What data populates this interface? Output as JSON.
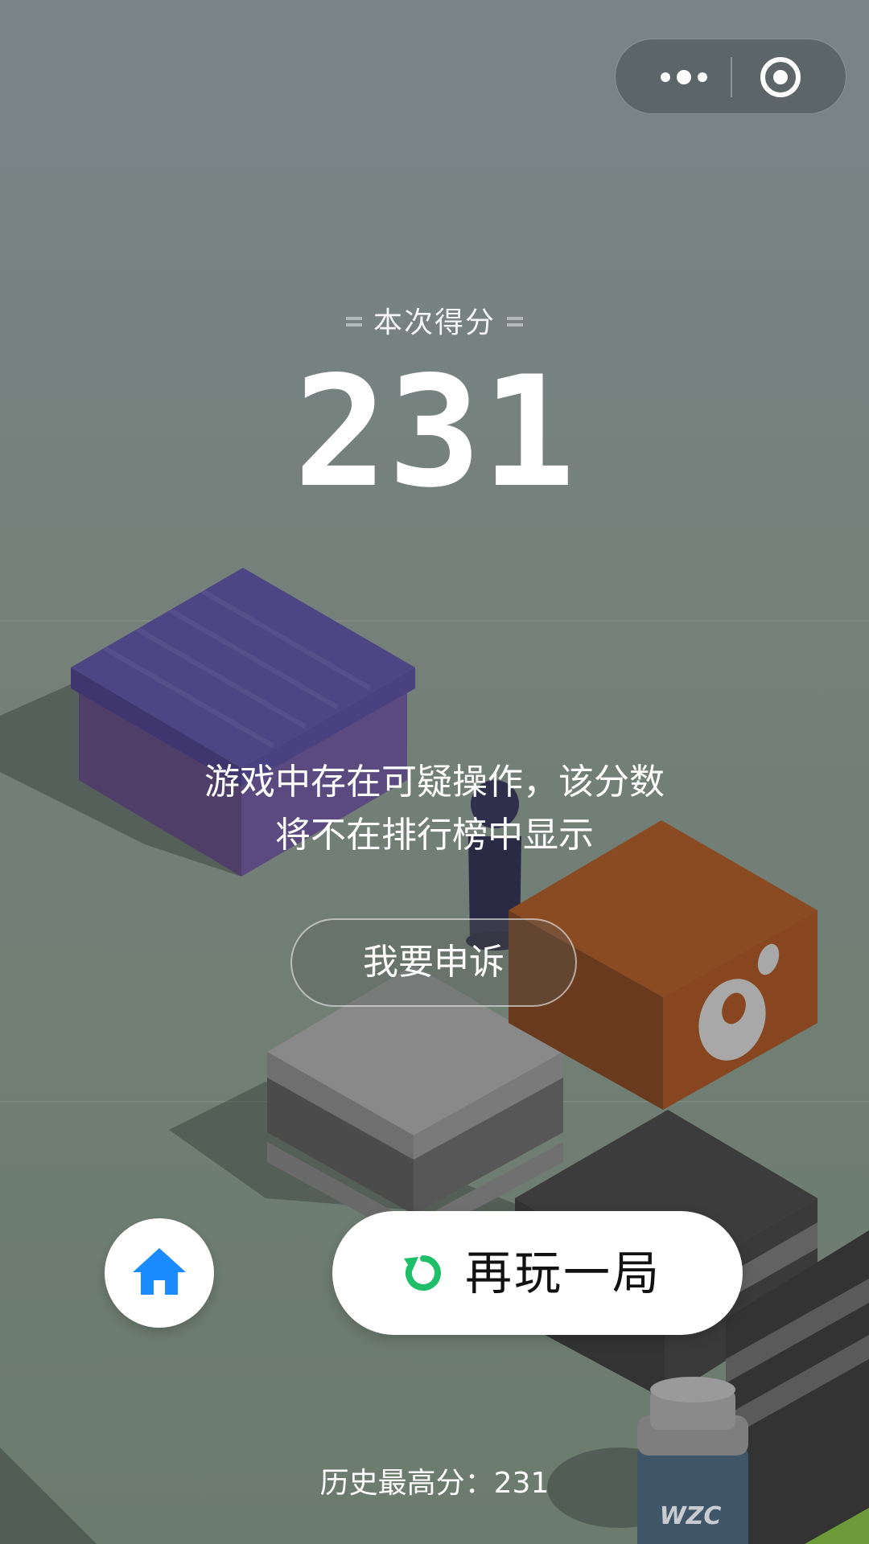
{
  "colors": {
    "accent_green": "#1fbf6a",
    "home_blue": "#1a8cff",
    "purple_box": "#53457d",
    "orange_box": "#8a4a22",
    "gray_box": "#8a8a8a"
  },
  "top_capsule": {
    "more_icon": "more-dots-icon",
    "close_icon": "target-circle-icon"
  },
  "score": {
    "label": "本次得分",
    "value": "231"
  },
  "notice": {
    "line1": "游戏中存在可疑操作，该分数",
    "line2": "将不在排行榜中显示"
  },
  "appeal_button": {
    "label": "我要申诉"
  },
  "home_button": {
    "icon": "home-icon"
  },
  "replay_button": {
    "icon": "replay-icon",
    "label": "再玩一局"
  },
  "best_score": {
    "text": "历史最高分：231"
  },
  "scene": {
    "bottle_label": "WZC"
  }
}
